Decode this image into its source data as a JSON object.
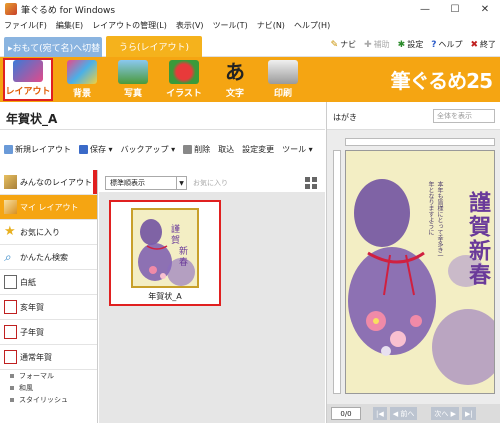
{
  "window": {
    "title": "筆ぐるめ for Windows",
    "minimize": "—",
    "maximize": "☐",
    "close": "✕"
  },
  "menu": [
    "ファイル(F)",
    "編集(E)",
    "レイアウトの管理(L)",
    "表示(V)",
    "ツール(T)",
    "ナビ(N)",
    "ヘルプ(H)"
  ],
  "modes": {
    "front": "▸おもて(宛て名)へ切替",
    "back": "うら(レイアウト)"
  },
  "quicklinks": [
    {
      "label": "ナビ",
      "icon": "navi-icon",
      "color": "#c89000"
    },
    {
      "label": "補助",
      "icon": "assist-icon",
      "color": "#aaa"
    },
    {
      "label": "設定",
      "icon": "gear-icon",
      "color": "#2a8a2a"
    },
    {
      "label": "ヘルプ",
      "icon": "help-icon",
      "color": "#2a5ac8"
    },
    {
      "label": "終了",
      "icon": "exit-icon",
      "color": "#c02020"
    }
  ],
  "ribbon": {
    "buttons": [
      "レイアウト",
      "背景",
      "写真",
      "イラスト",
      "文字",
      "印刷"
    ],
    "brand": "筆ぐるめ25"
  },
  "page_title": "年賀状_A",
  "toolbar": [
    "新規レイアウト",
    "保存",
    "バックアップ",
    "削除",
    "取込",
    "設定変更",
    "ツール"
  ],
  "sidebar": {
    "items": [
      "みんなのレイアウト",
      "マイ レイアウト",
      "お気に入り",
      "かんたん検索",
      "白紙",
      "亥年賀",
      "子年賀",
      "通常年賀"
    ],
    "subitems": [
      "フォーマル",
      "和風",
      "スタイリッシュ"
    ]
  },
  "content": {
    "sort": "標準順表示",
    "favorites": "お気に入り",
    "card_label": "年賀状_A"
  },
  "preview": {
    "label": "はがき",
    "select_placeholder": "全体を表示",
    "page": "0/0",
    "prev": "前へ",
    "next": "次へ",
    "card_text_big": "謹賀新春",
    "card_text_small": "本年も皆様にとって幸多き一年となりますように"
  }
}
